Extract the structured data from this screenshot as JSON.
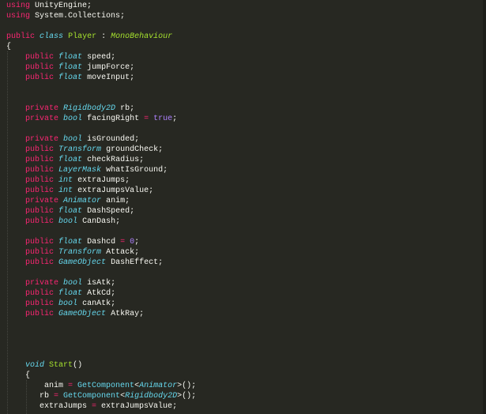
{
  "editor": {
    "colors": {
      "background": "#272822",
      "keyword": "#F92672",
      "type": "#66D9EF",
      "class": "#A6E22E",
      "constant": "#AE81FF",
      "text": "#F8F8F2"
    },
    "lines": [
      [
        [
          "kw",
          "using"
        ],
        [
          "pl",
          " UnityEngine;"
        ]
      ],
      [
        [
          "kw",
          "using"
        ],
        [
          "pl",
          " System.Collections;"
        ]
      ],
      [],
      [
        [
          "kw",
          "public"
        ],
        [
          "pl",
          " "
        ],
        [
          "type",
          "class"
        ],
        [
          "pl",
          " "
        ],
        [
          "cls",
          "Player"
        ],
        [
          "pl",
          " : "
        ],
        [
          "inh",
          "MonoBehaviour"
        ]
      ],
      [
        [
          "pl",
          "{"
        ]
      ],
      [
        [
          "pl",
          "    "
        ],
        [
          "kw",
          "public"
        ],
        [
          "pl",
          " "
        ],
        [
          "type",
          "float"
        ],
        [
          "pl",
          " speed;"
        ]
      ],
      [
        [
          "pl",
          "    "
        ],
        [
          "kw",
          "public"
        ],
        [
          "pl",
          " "
        ],
        [
          "type",
          "float"
        ],
        [
          "pl",
          " jumpForce;"
        ]
      ],
      [
        [
          "pl",
          "    "
        ],
        [
          "kw",
          "public"
        ],
        [
          "pl",
          " "
        ],
        [
          "type",
          "float"
        ],
        [
          "pl",
          " moveInput;"
        ]
      ],
      [],
      [],
      [
        [
          "pl",
          "    "
        ],
        [
          "kw",
          "private"
        ],
        [
          "pl",
          " "
        ],
        [
          "type",
          "Rigidbody2D"
        ],
        [
          "pl",
          " rb;"
        ]
      ],
      [
        [
          "pl",
          "    "
        ],
        [
          "kw",
          "private"
        ],
        [
          "pl",
          " "
        ],
        [
          "type",
          "bool"
        ],
        [
          "pl",
          " facingRight "
        ],
        [
          "op",
          "="
        ],
        [
          "pl",
          " "
        ],
        [
          "const",
          "true"
        ],
        [
          "pl",
          ";"
        ]
      ],
      [],
      [
        [
          "pl",
          "    "
        ],
        [
          "kw",
          "private"
        ],
        [
          "pl",
          " "
        ],
        [
          "type",
          "bool"
        ],
        [
          "pl",
          " isGrounded;"
        ]
      ],
      [
        [
          "pl",
          "    "
        ],
        [
          "kw",
          "public"
        ],
        [
          "pl",
          " "
        ],
        [
          "type",
          "Transform"
        ],
        [
          "pl",
          " groundCheck;"
        ]
      ],
      [
        [
          "pl",
          "    "
        ],
        [
          "kw",
          "public"
        ],
        [
          "pl",
          " "
        ],
        [
          "type",
          "float"
        ],
        [
          "pl",
          " checkRadius;"
        ]
      ],
      [
        [
          "pl",
          "    "
        ],
        [
          "kw",
          "public"
        ],
        [
          "pl",
          " "
        ],
        [
          "type",
          "LayerMask"
        ],
        [
          "pl",
          " whatIsGround;"
        ]
      ],
      [
        [
          "pl",
          "    "
        ],
        [
          "kw",
          "public"
        ],
        [
          "pl",
          " "
        ],
        [
          "type",
          "int"
        ],
        [
          "pl",
          " extraJumps;"
        ]
      ],
      [
        [
          "pl",
          "    "
        ],
        [
          "kw",
          "public"
        ],
        [
          "pl",
          " "
        ],
        [
          "type",
          "int"
        ],
        [
          "pl",
          " extraJumpsValue;"
        ]
      ],
      [
        [
          "pl",
          "    "
        ],
        [
          "kw",
          "private"
        ],
        [
          "pl",
          " "
        ],
        [
          "type",
          "Animator"
        ],
        [
          "pl",
          " anim;"
        ]
      ],
      [
        [
          "pl",
          "    "
        ],
        [
          "kw",
          "public"
        ],
        [
          "pl",
          " "
        ],
        [
          "type",
          "float"
        ],
        [
          "pl",
          " DashSpeed;"
        ]
      ],
      [
        [
          "pl",
          "    "
        ],
        [
          "kw",
          "public"
        ],
        [
          "pl",
          " "
        ],
        [
          "type",
          "bool"
        ],
        [
          "pl",
          " CanDash;"
        ]
      ],
      [],
      [
        [
          "pl",
          "    "
        ],
        [
          "kw",
          "public"
        ],
        [
          "pl",
          " "
        ],
        [
          "type",
          "float"
        ],
        [
          "pl",
          " Dashcd "
        ],
        [
          "op",
          "="
        ],
        [
          "pl",
          " "
        ],
        [
          "const",
          "0"
        ],
        [
          "pl",
          ";"
        ]
      ],
      [
        [
          "pl",
          "    "
        ],
        [
          "kw",
          "public"
        ],
        [
          "pl",
          " "
        ],
        [
          "type",
          "Transform"
        ],
        [
          "pl",
          " Attack;"
        ]
      ],
      [
        [
          "pl",
          "    "
        ],
        [
          "kw",
          "public"
        ],
        [
          "pl",
          " "
        ],
        [
          "type",
          "GameObject"
        ],
        [
          "pl",
          " DashEffect;"
        ]
      ],
      [],
      [
        [
          "pl",
          "    "
        ],
        [
          "kw",
          "private"
        ],
        [
          "pl",
          " "
        ],
        [
          "type",
          "bool"
        ],
        [
          "pl",
          " isAtk;"
        ]
      ],
      [
        [
          "pl",
          "    "
        ],
        [
          "kw",
          "public"
        ],
        [
          "pl",
          " "
        ],
        [
          "type",
          "float"
        ],
        [
          "pl",
          " AtkCd;"
        ]
      ],
      [
        [
          "pl",
          "    "
        ],
        [
          "kw",
          "public"
        ],
        [
          "pl",
          " "
        ],
        [
          "type",
          "bool"
        ],
        [
          "pl",
          " canAtk;"
        ]
      ],
      [
        [
          "pl",
          "    "
        ],
        [
          "kw",
          "public"
        ],
        [
          "pl",
          " "
        ],
        [
          "type",
          "GameObject"
        ],
        [
          "pl",
          " AtkRay;"
        ]
      ],
      [],
      [],
      [],
      [],
      [
        [
          "pl",
          "    "
        ],
        [
          "type",
          "void"
        ],
        [
          "pl",
          " "
        ],
        [
          "cls",
          "Start"
        ],
        [
          "pl",
          "()"
        ]
      ],
      [
        [
          "pl",
          "    {"
        ]
      ],
      [
        [
          "pl",
          "        anim "
        ],
        [
          "op",
          "="
        ],
        [
          "pl",
          " "
        ],
        [
          "fn",
          "GetComponent"
        ],
        [
          "pl",
          "<"
        ],
        [
          "type",
          "Animator"
        ],
        [
          "pl",
          ">();"
        ]
      ],
      [
        [
          "pl",
          "       rb "
        ],
        [
          "op",
          "="
        ],
        [
          "pl",
          " "
        ],
        [
          "fn",
          "GetComponent"
        ],
        [
          "pl",
          "<"
        ],
        [
          "type",
          "Rigidbody2D"
        ],
        [
          "pl",
          ">();"
        ]
      ],
      [
        [
          "pl",
          "       extraJumps "
        ],
        [
          "op",
          "="
        ],
        [
          "pl",
          " extraJumpsValue;"
        ]
      ]
    ]
  }
}
